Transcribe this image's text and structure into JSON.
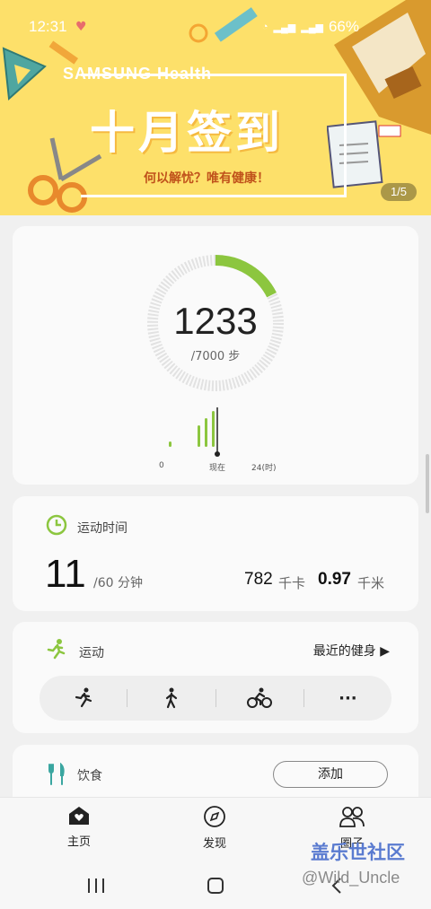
{
  "status_bar": {
    "time": "12:31",
    "battery": "66%"
  },
  "banner": {
    "brand": "SAMSUNG Health",
    "title": "十月签到",
    "subtitle": "何以解忧？唯有健康！",
    "page_indicator": "1/5",
    "colors": {
      "background": "#fde06a",
      "subtitle": "#c0521b"
    }
  },
  "steps": {
    "count": "1233",
    "goal_text": "/7000 步",
    "progress_fraction": 0.176,
    "axis_start": "0",
    "axis_now": "现在",
    "axis_end": "24(时)",
    "accent_color": "#8cc63f"
  },
  "active_time": {
    "title": "运动时间",
    "minutes": "11",
    "goal_text": "/60 分钟",
    "kcal_value": "782",
    "kcal_unit": "千卡",
    "distance_value": "0.97",
    "distance_unit": "千米",
    "icon": "clock-icon"
  },
  "exercise": {
    "title": "运动",
    "recent_link": "最近的健身 ▶",
    "buttons": [
      "running-icon",
      "walking-icon",
      "cycling-icon",
      "more-icon"
    ],
    "more_label": "···"
  },
  "food": {
    "title": "饮食",
    "add_label": "添加",
    "icon": "fork-knife-icon"
  },
  "bottom_nav": {
    "home": "主页",
    "discover": "发现",
    "together": "圈子"
  },
  "watermark": {
    "line1": "盖乐世社区",
    "line2": "@Wild_Uncle"
  }
}
